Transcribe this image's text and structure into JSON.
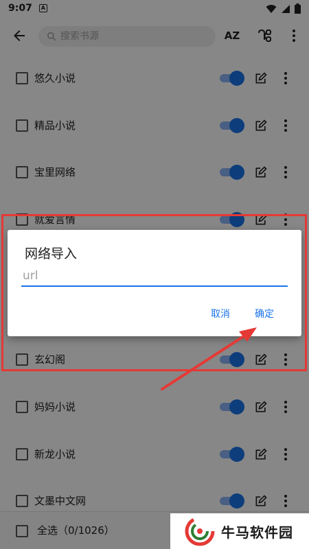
{
  "status_bar": {
    "time": "9:07",
    "notification_letter": "A"
  },
  "toolbar": {
    "search_placeholder": "搜索书源",
    "sort_label": "AZ",
    "icons": [
      "back-arrow-icon",
      "search-icon",
      "sort-az-icon",
      "group-icon",
      "more-vert-icon"
    ]
  },
  "sources": [
    {
      "name": "悠久小说",
      "enabled": true
    },
    {
      "name": "精品小说",
      "enabled": true
    },
    {
      "name": "宝里网络",
      "enabled": true
    },
    {
      "name": "就爱言情",
      "enabled": true
    },
    {
      "name": "玄幻阁",
      "enabled": true
    },
    {
      "name": "妈妈小说",
      "enabled": true
    },
    {
      "name": "新龙小说",
      "enabled": true
    },
    {
      "name": "文墨中文网",
      "enabled": true
    }
  ],
  "bottom_bar": {
    "select_all_label": "全选（0/1026）"
  },
  "dialog": {
    "title": "网络导入",
    "input_placeholder": "url",
    "input_value": "",
    "cancel_label": "取消",
    "confirm_label": "确定"
  },
  "watermark": {
    "text": "牛马软件园"
  },
  "colors": {
    "accent": "#1a73e8",
    "annotation_red": "#e53935",
    "scrim": "rgba(0,0,0,0.47)"
  }
}
